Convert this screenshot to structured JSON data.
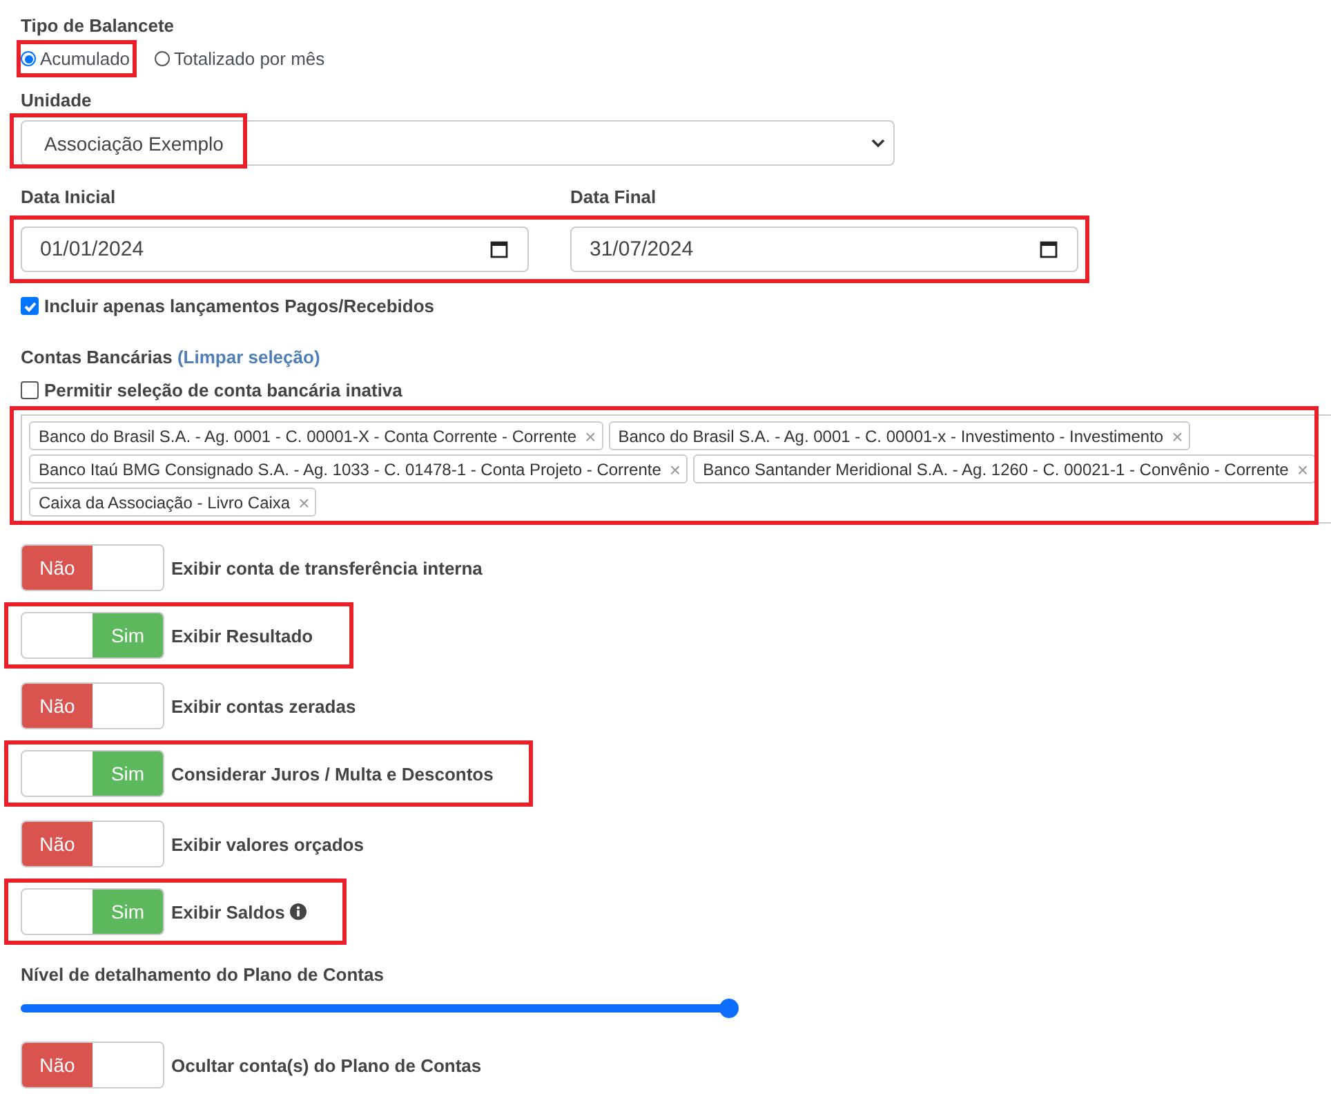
{
  "tipo_de_balancete": {
    "label": "Tipo de Balancete",
    "options": [
      {
        "label": "Acumulado",
        "selected": true,
        "highlighted": true
      },
      {
        "label": "Totalizado por mês",
        "selected": false,
        "highlighted": false
      }
    ]
  },
  "unidade": {
    "label": "Unidade",
    "value": "Associação Exemplo",
    "highlighted": true
  },
  "datas": {
    "highlighted": true,
    "fields": [
      {
        "label": "Data Inicial",
        "value": "01/01/2024"
      },
      {
        "label": "Data Final",
        "value": "31/07/2024"
      }
    ]
  },
  "incluir_pagos": {
    "label": "Incluir apenas lançamentos Pagos/Recebidos",
    "checked": true
  },
  "contas_bancarias": {
    "label": "Contas Bancárias",
    "link": "(Limpar seleção)",
    "highlighted": true,
    "permitir_inativa": {
      "label": "Permitir seleção de conta bancária inativa",
      "checked": false
    },
    "tags": [
      {
        "label": "Banco do Brasil S.A. - Ag. 0001 - C. 00001-X - Conta Corrente - Corrente",
        "remove": "×"
      },
      {
        "label": "Banco do Brasil S.A. - Ag. 0001 - C. 00001-x - Investimento - Investimento",
        "remove": "×"
      },
      {
        "label": "Banco Itaú BMG Consignado S.A. - Ag. 1033 - C. 01478-1 - Conta Projeto - Corrente",
        "remove": "×"
      },
      {
        "label": "Banco Santander Meridional S.A. - Ag. 1260 - C. 00021-1 - Convênio - Corrente",
        "remove": "×"
      },
      {
        "label": "Caixa da Associação - Livro Caixa",
        "remove": "×"
      }
    ]
  },
  "options": [
    {
      "kind": "toggle",
      "state_label": "Não",
      "on": false,
      "label": "Exibir conta de transferência interna",
      "highlighted": false
    },
    {
      "kind": "toggle",
      "state_label": "Sim",
      "on": true,
      "label": "Exibir Resultado",
      "highlighted": true
    },
    {
      "kind": "toggle",
      "state_label": "Não",
      "on": false,
      "label": "Exibir contas zeradas",
      "highlighted": false
    },
    {
      "kind": "toggle",
      "state_label": "Sim",
      "on": true,
      "label": "Considerar Juros / Multa e Descontos",
      "highlighted": true
    },
    {
      "kind": "toggle",
      "state_label": "Não",
      "on": false,
      "label": "Exibir valores orçados",
      "highlighted": false
    },
    {
      "kind": "toggle",
      "state_label": "Sim",
      "on": true,
      "label": "Exibir Saldos",
      "info": true,
      "highlighted": true
    },
    {
      "kind": "slider",
      "label": "Nível de detalhamento do Plano de Contas",
      "level": 1
    },
    {
      "kind": "toggle",
      "state_label": "Não",
      "on": false,
      "label": "Ocultar conta(s) do Plano de Contas",
      "highlighted": false
    }
  ]
}
